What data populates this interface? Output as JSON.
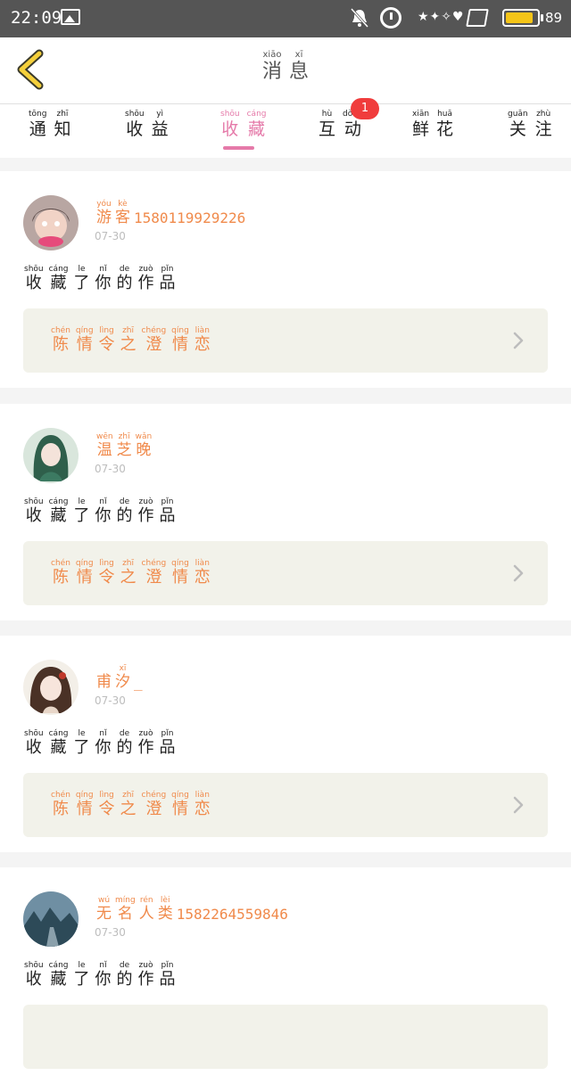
{
  "status_bar": {
    "time": "22:09",
    "battery_level": 89,
    "battery_color": "#f5c518",
    "icons": [
      "image-icon",
      "mute-bell-icon",
      "alarm-icon",
      "wind-chime-icon",
      "sim-icon",
      "battery-icon"
    ]
  },
  "header": {
    "title": [
      {
        "pin": "xiāo",
        "han": "消"
      },
      {
        "pin": "xī",
        "han": "息"
      }
    ],
    "back_icon": "chevron-left-icon",
    "back_color": "#f5d03b"
  },
  "tabs": [
    {
      "chars": [
        {
          "pin": "tōng",
          "han": "通"
        },
        {
          "pin": "zhī",
          "han": "知"
        }
      ]
    },
    {
      "chars": [
        {
          "pin": "shōu",
          "han": "收"
        },
        {
          "pin": "yì",
          "han": "益"
        }
      ]
    },
    {
      "chars": [
        {
          "pin": "shōu",
          "han": "收"
        },
        {
          "pin": "cáng",
          "han": "藏"
        }
      ],
      "active": true
    },
    {
      "chars": [
        {
          "pin": "hù",
          "han": "互"
        },
        {
          "pin": "dòng",
          "han": "动"
        }
      ],
      "badge": "1"
    },
    {
      "chars": [
        {
          "pin": "xiān",
          "han": "鲜"
        },
        {
          "pin": "huā",
          "han": "花"
        }
      ]
    },
    {
      "chars": [
        {
          "pin": "guān",
          "han": "关"
        },
        {
          "pin": "zhù",
          "han": "注"
        }
      ]
    }
  ],
  "accent_color": "#e57aa9",
  "cards": [
    {
      "user": {
        "chars": [
          {
            "pin": "yóu",
            "han": "游"
          },
          {
            "pin": "kè",
            "han": "客"
          }
        ],
        "suffix": "15801199292​26"
      },
      "date": "07-30",
      "action": [
        {
          "pin": "shōu",
          "han": "收"
        },
        {
          "pin": "cáng",
          "han": "藏"
        },
        {
          "pin": "le",
          "han": "了"
        },
        {
          "pin": "nǐ",
          "han": "你"
        },
        {
          "pin": "de",
          "han": "的"
        },
        {
          "pin": "zuò",
          "han": "作"
        },
        {
          "pin": "pǐn",
          "han": "品"
        }
      ],
      "work": [
        {
          "pin": "chén",
          "han": "陈"
        },
        {
          "pin": "qíng",
          "han": "情"
        },
        {
          "pin": "lìng",
          "han": "令"
        },
        {
          "pin": "zhī",
          "han": "之"
        },
        {
          "pin": "chéng",
          "han": "澄"
        },
        {
          "pin": "qíng",
          "han": "情"
        },
        {
          "pin": "liàn",
          "han": "恋"
        }
      ]
    },
    {
      "user": {
        "chars": [
          {
            "pin": "wēn",
            "han": "温"
          },
          {
            "pin": "zhī",
            "han": "芝"
          },
          {
            "pin": "wǎn",
            "han": "晚"
          }
        ],
        "suffix": ""
      },
      "date": "07-30",
      "action": [
        {
          "pin": "shōu",
          "han": "收"
        },
        {
          "pin": "cáng",
          "han": "藏"
        },
        {
          "pin": "le",
          "han": "了"
        },
        {
          "pin": "nǐ",
          "han": "你"
        },
        {
          "pin": "de",
          "han": "的"
        },
        {
          "pin": "zuò",
          "han": "作"
        },
        {
          "pin": "pǐn",
          "han": "品"
        }
      ],
      "work": [
        {
          "pin": "chén",
          "han": "陈"
        },
        {
          "pin": "qíng",
          "han": "情"
        },
        {
          "pin": "lìng",
          "han": "令"
        },
        {
          "pin": "zhī",
          "han": "之"
        },
        {
          "pin": "chéng",
          "han": "澄"
        },
        {
          "pin": "qíng",
          "han": "情"
        },
        {
          "pin": "liàn",
          "han": "恋"
        }
      ]
    },
    {
      "user": {
        "chars": [
          {
            "pin": "",
            "han": "甫"
          },
          {
            "pin": "xī",
            "han": "汐"
          }
        ],
        "suffix": "_"
      },
      "date": "07-30",
      "action": [
        {
          "pin": "shōu",
          "han": "收"
        },
        {
          "pin": "cáng",
          "han": "藏"
        },
        {
          "pin": "le",
          "han": "了"
        },
        {
          "pin": "nǐ",
          "han": "你"
        },
        {
          "pin": "de",
          "han": "的"
        },
        {
          "pin": "zuò",
          "han": "作"
        },
        {
          "pin": "pǐn",
          "han": "品"
        }
      ],
      "work": [
        {
          "pin": "chén",
          "han": "陈"
        },
        {
          "pin": "qíng",
          "han": "情"
        },
        {
          "pin": "lìng",
          "han": "令"
        },
        {
          "pin": "zhī",
          "han": "之"
        },
        {
          "pin": "chéng",
          "han": "澄"
        },
        {
          "pin": "qíng",
          "han": "情"
        },
        {
          "pin": "liàn",
          "han": "恋"
        }
      ]
    },
    {
      "user": {
        "chars": [
          {
            "pin": "wú",
            "han": "无"
          },
          {
            "pin": "míng",
            "han": "名"
          },
          {
            "pin": "rén",
            "han": "人"
          },
          {
            "pin": "lèi",
            "han": "类"
          }
        ],
        "suffix": "1582264559846"
      },
      "date": "07-30",
      "action": [
        {
          "pin": "shōu",
          "han": "收"
        },
        {
          "pin": "cáng",
          "han": "藏"
        },
        {
          "pin": "le",
          "han": "了"
        },
        {
          "pin": "nǐ",
          "han": "你"
        },
        {
          "pin": "de",
          "han": "的"
        },
        {
          "pin": "zuò",
          "han": "作"
        },
        {
          "pin": "pǐn",
          "han": "品"
        }
      ],
      "work": []
    }
  ]
}
